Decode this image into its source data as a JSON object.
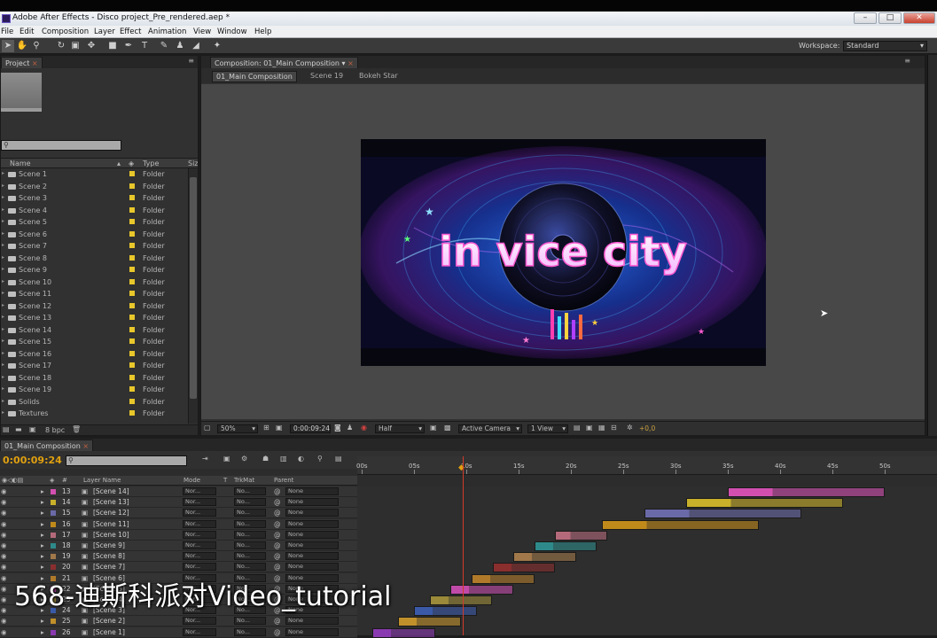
{
  "window": {
    "title": "Adobe After Effects - Disco project_Pre_rendered.aep *",
    "controls": [
      "–",
      "□",
      "✕"
    ]
  },
  "menu": [
    "File",
    "Edit",
    "Composition",
    "Layer",
    "Effect",
    "Animation",
    "View",
    "Window",
    "Help"
  ],
  "toolbar": {
    "workspace_label": "Workspace:",
    "workspace_value": "Standard"
  },
  "project": {
    "tab": "Project",
    "columns": {
      "name": "Name",
      "type": "Type",
      "size": "Size"
    },
    "items": [
      {
        "name": "Scene 1",
        "type": "Folder"
      },
      {
        "name": "Scene 2",
        "type": "Folder"
      },
      {
        "name": "Scene 3",
        "type": "Folder"
      },
      {
        "name": "Scene 4",
        "type": "Folder"
      },
      {
        "name": "Scene 5",
        "type": "Folder"
      },
      {
        "name": "Scene 6",
        "type": "Folder"
      },
      {
        "name": "Scene 7",
        "type": "Folder"
      },
      {
        "name": "Scene 8",
        "type": "Folder"
      },
      {
        "name": "Scene 9",
        "type": "Folder"
      },
      {
        "name": "Scene 10",
        "type": "Folder"
      },
      {
        "name": "Scene 11",
        "type": "Folder"
      },
      {
        "name": "Scene 12",
        "type": "Folder"
      },
      {
        "name": "Scene 13",
        "type": "Folder"
      },
      {
        "name": "Scene 14",
        "type": "Folder"
      },
      {
        "name": "Scene 15",
        "type": "Folder"
      },
      {
        "name": "Scene 16",
        "type": "Folder"
      },
      {
        "name": "Scene 17",
        "type": "Folder"
      },
      {
        "name": "Scene 18",
        "type": "Folder"
      },
      {
        "name": "Scene 19",
        "type": "Folder"
      },
      {
        "name": "Solids",
        "type": "Folder"
      },
      {
        "name": "Textures",
        "type": "Folder"
      }
    ],
    "bpc": "8 bpc",
    "label_color": "#e8c72a"
  },
  "composition": {
    "tab": "Composition: 01_Main Composition",
    "breadcrumbs": [
      "01_Main Composition",
      "Scene 19",
      "Bokeh Star"
    ],
    "frame_text": "in vice city",
    "zoom": "50%",
    "timecode": "0:00:09:24",
    "resolution": "Half",
    "camera": "Active Camera",
    "views": "1 View",
    "exposure": "+0,0"
  },
  "timeline": {
    "tab": "01_Main Composition",
    "timecode": "0:00:09:24",
    "ruler": [
      "00s",
      "05s",
      "10s",
      "15s",
      "20s",
      "25s",
      "30s",
      "35s",
      "40s",
      "45s",
      "50s"
    ],
    "columns": {
      "num": "#",
      "layer_name": "Layer Name",
      "mode": "Mode",
      "t": "T",
      "trkmat": "TrkMat",
      "parent": "Parent"
    },
    "mode_value": "Nor...",
    "trkmat_value": "No...",
    "parent_value": "None",
    "layers": [
      {
        "num": "13",
        "name": "[Scene 14]",
        "color": "#d24fb0",
        "start": 35,
        "end": 50
      },
      {
        "num": "14",
        "name": "[Scene 13]",
        "color": "#c8b02a",
        "start": 31,
        "end": 46
      },
      {
        "num": "15",
        "name": "[Scene 12]",
        "color": "#6a6aa8",
        "start": 27,
        "end": 42
      },
      {
        "num": "16",
        "name": "[Scene 11]",
        "color": "#c08a1a",
        "start": 23,
        "end": 38
      },
      {
        "num": "17",
        "name": "[Scene 10]",
        "color": "#b46a7a",
        "start": 18.5,
        "end": 23.5
      },
      {
        "num": "18",
        "name": "[Scene 9]",
        "color": "#2e8a8a",
        "start": 16.5,
        "end": 22.5
      },
      {
        "num": "19",
        "name": "[Scene 8]",
        "color": "#a0784a",
        "start": 14.5,
        "end": 20.5
      },
      {
        "num": "20",
        "name": "[Scene 7]",
        "color": "#8a2e2e",
        "start": 12.5,
        "end": 18.5
      },
      {
        "num": "21",
        "name": "[Scene 6]",
        "color": "#b07a2a",
        "start": 10.5,
        "end": 16.5
      },
      {
        "num": "22",
        "name": "[Scene 5]",
        "color": "#c04aa8",
        "start": 8.5,
        "end": 14.5
      },
      {
        "num": "23",
        "name": "[Scene 4]",
        "color": "#9a8a3a",
        "start": 6.5,
        "end": 12.5
      },
      {
        "num": "24",
        "name": "[Scene 3]",
        "color": "#3a5aa8",
        "start": 5,
        "end": 11
      },
      {
        "num": "25",
        "name": "[Scene 2]",
        "color": "#c0902a",
        "start": 3.5,
        "end": 9.5
      },
      {
        "num": "26",
        "name": "[Scene 1]",
        "color": "#8a3ab0",
        "start": 1,
        "end": 7
      }
    ]
  },
  "caption": "568-迪斯科派对Video_tutorial"
}
